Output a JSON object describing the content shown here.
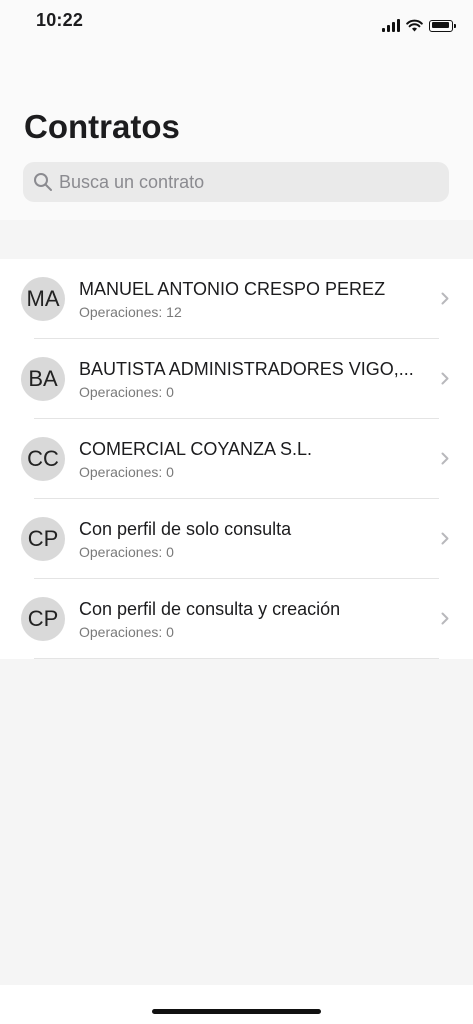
{
  "status_bar": {
    "time": "10:22"
  },
  "header": {
    "title": "Contratos",
    "search_placeholder": "Busca un contrato"
  },
  "contracts": [
    {
      "initials": "MA",
      "name": "MANUEL ANTONIO CRESPO PEREZ",
      "operations": "Operaciones: 12"
    },
    {
      "initials": "BA",
      "name": "BAUTISTA ADMINISTRADORES VIGO,...",
      "operations": "Operaciones: 0"
    },
    {
      "initials": "CC",
      "name": "COMERCIAL COYANZA S.L.",
      "operations": "Operaciones: 0"
    },
    {
      "initials": "CP",
      "name": "Con perfil de solo consulta",
      "operations": "Operaciones: 0"
    },
    {
      "initials": "CP",
      "name": "Con perfil de consulta y creación",
      "operations": "Operaciones: 0"
    }
  ],
  "icons": {
    "signal": "cellular-signal-icon",
    "wifi": "wifi-icon",
    "battery": "battery-icon",
    "search": "search-icon",
    "chevron": "chevron-right-icon"
  }
}
